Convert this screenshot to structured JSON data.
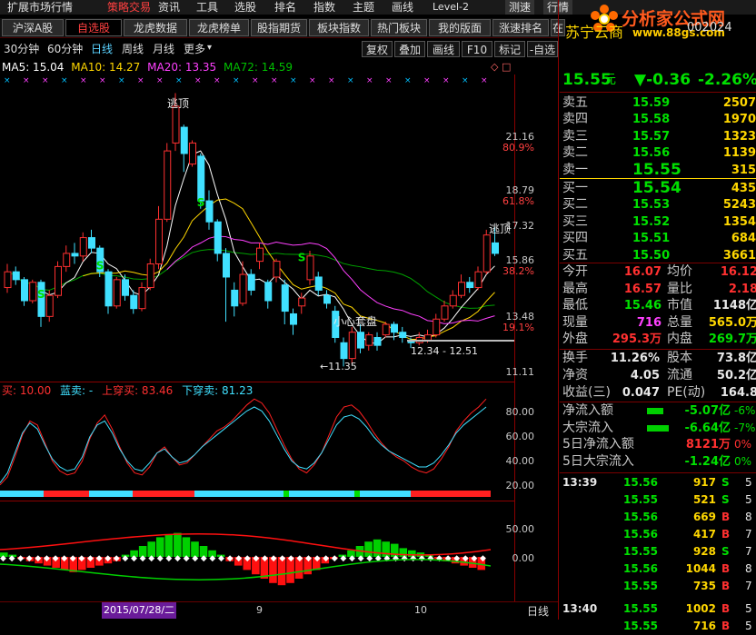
{
  "menu": {
    "items": [
      "扩展市场行情",
      "策略交易",
      "资讯",
      "工具",
      "选股",
      "排名",
      "指数",
      "主题",
      "画线",
      "Level-2"
    ],
    "right": [
      "测速",
      "行情"
    ]
  },
  "logo": {
    "title": "分析家公式网",
    "url": "www.88gs.com"
  },
  "tabs": [
    "沪深A股",
    "自选股",
    "龙虎数据",
    "龙虎榜单",
    "股指期货",
    "板块指数",
    "热门板块",
    "我的版面",
    "涨速排名",
    "在"
  ],
  "periods": {
    "items": [
      "30分钟",
      "60分钟",
      "日线",
      "周线",
      "月线",
      "更多"
    ],
    "active": "日线"
  },
  "toolbar": [
    "复权",
    "叠加",
    "画线",
    "F10",
    "标记",
    "-自选"
  ],
  "ma_legend": {
    "ma5": "MA5: 15.04",
    "ma10": "MA10: 14.27",
    "ma20": "MA20: 13.35",
    "ma72": "MA72: 14.59"
  },
  "price_axis": {
    "labels": [
      {
        "text": "21.16",
        "pct": "80.9%"
      },
      {
        "text": "18.79",
        "pct": "61.8%"
      },
      {
        "text": "17.32",
        "pct": ""
      },
      {
        "text": "15.86",
        "pct": "38.2%"
      },
      {
        "text": "13.48",
        "pct": "19.1%"
      },
      {
        "text": "11.11",
        "pct": ""
      }
    ]
  },
  "annotations": {
    "top1": "逃顶",
    "top2": "逃顶",
    "hold": "小心套盘",
    "low": "11.35",
    "range": "12.34 - 12.51",
    "buy": "S"
  },
  "osc_legend": {
    "a": "买: 10.00",
    "b": "蓝卖: -",
    "c": "上穿买: 83.46",
    "d": "下穿卖: 81.23"
  },
  "osc_axis": [
    "80.00",
    "60.00",
    "40.00",
    "20.00"
  ],
  "macd_axis": [
    "50.00",
    "0.00"
  ],
  "dates": {
    "d1": "2015/07/28/二",
    "d2": "9",
    "d3": "10",
    "period": "日线"
  },
  "quote": {
    "name": "苏宁云商",
    "code": "002024",
    "price": "15.55",
    "unit": "元",
    "change": "▼-0.36",
    "pct": "-2.26%",
    "asks": [
      {
        "label": "卖五",
        "price": "15.59",
        "vol": "2507"
      },
      {
        "label": "卖四",
        "price": "15.58",
        "vol": "1970"
      },
      {
        "label": "卖三",
        "price": "15.57",
        "vol": "1323"
      },
      {
        "label": "卖二",
        "price": "15.56",
        "vol": "1139"
      },
      {
        "label": "卖一",
        "price": "15.55",
        "vol": "315"
      }
    ],
    "bids": [
      {
        "label": "买一",
        "price": "15.54",
        "vol": "435"
      },
      {
        "label": "买二",
        "price": "15.53",
        "vol": "5243"
      },
      {
        "label": "买三",
        "price": "15.52",
        "vol": "1354"
      },
      {
        "label": "买四",
        "price": "15.51",
        "vol": "684"
      },
      {
        "label": "买五",
        "price": "15.50",
        "vol": "3661"
      }
    ],
    "stats": [
      {
        "l1": "今开",
        "v1": "16.07",
        "l2": "均价",
        "v2": "16.12"
      },
      {
        "l1": "最高",
        "v1": "16.57",
        "l2": "量比",
        "v2": "2.18"
      },
      {
        "l1": "最低",
        "v1": "15.46",
        "l2": "市值",
        "v2": "1148亿"
      },
      {
        "l1": "现量",
        "v1": "716",
        "l2": "总量",
        "v2": "565.0万"
      },
      {
        "l1": "外盘",
        "v1": "295.3万",
        "l2": "内盘",
        "v2": "269.7万"
      }
    ],
    "fund": [
      {
        "l1": "换手",
        "v1": "11.26%",
        "l2": "股本",
        "v2": "73.8亿"
      },
      {
        "l1": "净资",
        "v1": "4.05",
        "l2": "流通",
        "v2": "50.2亿"
      },
      {
        "l1": "收益(三)",
        "v1": "0.047",
        "l2": "PE(动)",
        "v2": "164.8"
      }
    ],
    "flows": [
      {
        "label": "净流入额",
        "value": "-5.07亿",
        "pct": "-6%"
      },
      {
        "label": "大宗流入",
        "value": "-6.64亿",
        "pct": "-7%"
      },
      {
        "label": "5日净流入额",
        "value": "8121万",
        "pct": "0%"
      },
      {
        "label": "5日大宗流入",
        "value": "-1.24亿",
        "pct": "0%"
      }
    ],
    "ticks": [
      {
        "time": "13:39",
        "price": "15.56",
        "vol": "917",
        "side": "S",
        "n": "5"
      },
      {
        "time": "",
        "price": "15.55",
        "vol": "521",
        "side": "S",
        "n": "5"
      },
      {
        "time": "",
        "price": "15.56",
        "vol": "669",
        "side": "B",
        "n": "8"
      },
      {
        "time": "",
        "price": "15.56",
        "vol": "417",
        "side": "B",
        "n": "7"
      },
      {
        "time": "",
        "price": "15.55",
        "vol": "928",
        "side": "S",
        "n": "7"
      },
      {
        "time": "",
        "price": "15.56",
        "vol": "1044",
        "side": "B",
        "n": "8"
      },
      {
        "time": "",
        "price": "15.55",
        "vol": "735",
        "side": "B",
        "n": "7"
      },
      {
        "time": "13:40",
        "price": "15.55",
        "vol": "1002",
        "side": "B",
        "n": "5"
      },
      {
        "time": "",
        "price": "15.55",
        "vol": "716",
        "side": "B",
        "n": "5"
      }
    ]
  },
  "colors": {
    "up": "#ff3030",
    "down": "#40e0ff",
    "ma5": "#ffffff",
    "ma10": "#ffd700",
    "ma20": "#ff40ff",
    "ma72": "#00c000"
  },
  "chart_data": {
    "type": "candlestick",
    "candles": [
      {
        "o": 14.3,
        "c": 14.9,
        "h": 15.2,
        "l": 14.1
      },
      {
        "o": 14.9,
        "c": 14.6,
        "h": 15.1,
        "l": 14.4
      },
      {
        "o": 14.6,
        "c": 13.8,
        "h": 14.7,
        "l": 13.6
      },
      {
        "o": 13.8,
        "c": 14.5,
        "h": 14.6,
        "l": 13.7
      },
      {
        "o": 14.5,
        "c": 13.2,
        "h": 14.6,
        "l": 12.8
      },
      {
        "o": 13.2,
        "c": 14.0,
        "h": 14.2,
        "l": 13.0
      },
      {
        "o": 14.0,
        "c": 15.1,
        "h": 15.3,
        "l": 13.9
      },
      {
        "o": 15.1,
        "c": 15.6,
        "h": 15.9,
        "l": 14.9
      },
      {
        "o": 15.6,
        "c": 15.5,
        "h": 16.0,
        "l": 15.2
      },
      {
        "o": 15.5,
        "c": 16.2,
        "h": 16.4,
        "l": 15.3
      },
      {
        "o": 16.2,
        "c": 15.8,
        "h": 16.5,
        "l": 15.6
      },
      {
        "o": 15.8,
        "c": 14.9,
        "h": 15.9,
        "l": 14.7
      },
      {
        "o": 14.9,
        "c": 13.6,
        "h": 15.0,
        "l": 13.3
      },
      {
        "o": 13.6,
        "c": 14.6,
        "h": 14.7,
        "l": 13.5
      },
      {
        "o": 14.6,
        "c": 14.0,
        "h": 14.8,
        "l": 13.8
      },
      {
        "o": 14.0,
        "c": 13.5,
        "h": 14.2,
        "l": 13.3
      },
      {
        "o": 13.5,
        "c": 14.3,
        "h": 14.5,
        "l": 13.4
      },
      {
        "o": 14.3,
        "c": 15.2,
        "h": 15.4,
        "l": 14.2
      },
      {
        "o": 15.2,
        "c": 16.9,
        "h": 17.4,
        "l": 15.0
      },
      {
        "o": 16.9,
        "c": 19.5,
        "h": 19.8,
        "l": 16.8
      },
      {
        "o": 19.8,
        "c": 21.2,
        "h": 21.7,
        "l": 19.5
      },
      {
        "o": 20.4,
        "c": 19.4,
        "h": 20.5,
        "l": 18.7
      },
      {
        "o": 19.0,
        "c": 19.8,
        "h": 19.9,
        "l": 18.9
      },
      {
        "o": 19.3,
        "c": 17.6,
        "h": 19.4,
        "l": 17.3
      },
      {
        "o": 17.6,
        "c": 16.8,
        "h": 18.0,
        "l": 16.5
      },
      {
        "o": 16.8,
        "c": 15.6,
        "h": 16.9,
        "l": 15.3
      },
      {
        "o": 15.6,
        "c": 14.7,
        "h": 15.8,
        "l": 13.0
      },
      {
        "o": 14.2,
        "c": 13.6,
        "h": 14.5,
        "l": 13.2
      },
      {
        "o": 13.7,
        "c": 14.8,
        "h": 15.3,
        "l": 13.6
      },
      {
        "o": 14.8,
        "c": 14.2,
        "h": 15.0,
        "l": 14.0
      },
      {
        "o": 15.3,
        "c": 15.8,
        "h": 16.0,
        "l": 15.0
      },
      {
        "o": 14.5,
        "c": 13.8,
        "h": 14.6,
        "l": 13.5
      },
      {
        "o": 14.7,
        "c": 15.3,
        "h": 15.4,
        "l": 14.5
      },
      {
        "o": 14.4,
        "c": 13.4,
        "h": 14.6,
        "l": 12.9
      },
      {
        "o": 13.3,
        "c": 12.9,
        "h": 13.5,
        "l": 12.5
      },
      {
        "o": 13.6,
        "c": 13.9,
        "h": 14.1,
        "l": 13.3
      },
      {
        "o": 14.6,
        "c": 15.5,
        "h": 15.7,
        "l": 14.4
      },
      {
        "o": 14.7,
        "c": 14.2,
        "h": 14.9,
        "l": 14.0
      },
      {
        "o": 14.0,
        "c": 13.7,
        "h": 14.2,
        "l": 13.5
      },
      {
        "o": 13.4,
        "c": 12.4,
        "h": 13.6,
        "l": 12.2
      },
      {
        "o": 12.2,
        "c": 11.6,
        "h": 12.4,
        "l": 11.3
      },
      {
        "o": 11.6,
        "c": 12.6,
        "h": 12.8,
        "l": 11.4
      },
      {
        "o": 12.6,
        "c": 12.0,
        "h": 12.9,
        "l": 11.8
      },
      {
        "o": 12.1,
        "c": 12.5,
        "h": 12.6,
        "l": 11.9
      },
      {
        "o": 12.4,
        "c": 12.1,
        "h": 12.6,
        "l": 11.9
      },
      {
        "o": 12.5,
        "c": 12.9,
        "h": 13.0,
        "l": 12.4
      },
      {
        "o": 12.9,
        "c": 12.6,
        "h": 13.0,
        "l": 12.3
      },
      {
        "o": 12.6,
        "c": 12.4,
        "h": 12.8,
        "l": 12.2
      },
      {
        "o": 12.3,
        "c": 12.2,
        "h": 12.4,
        "l": 12.0
      },
      {
        "o": 12.2,
        "c": 12.4,
        "h": 12.6,
        "l": 12.1
      },
      {
        "o": 12.3,
        "c": 12.5,
        "h": 12.7,
        "l": 12.2
      },
      {
        "o": 12.5,
        "c": 13.1,
        "h": 13.3,
        "l": 12.4
      },
      {
        "o": 13.1,
        "c": 13.6,
        "h": 13.8,
        "l": 13.0
      },
      {
        "o": 13.6,
        "c": 14.0,
        "h": 14.2,
        "l": 13.5
      },
      {
        "o": 14.0,
        "c": 14.5,
        "h": 14.8,
        "l": 13.9
      },
      {
        "o": 14.5,
        "c": 14.3,
        "h": 14.7,
        "l": 14.1
      },
      {
        "o": 14.3,
        "c": 14.9,
        "h": 15.1,
        "l": 14.2
      },
      {
        "o": 14.9,
        "c": 16.3,
        "h": 16.5,
        "l": 14.8
      },
      {
        "o": 16.0,
        "c": 15.6,
        "h": 16.6,
        "l": 15.5
      }
    ],
    "y_range": [
      11.0,
      22.2
    ]
  }
}
